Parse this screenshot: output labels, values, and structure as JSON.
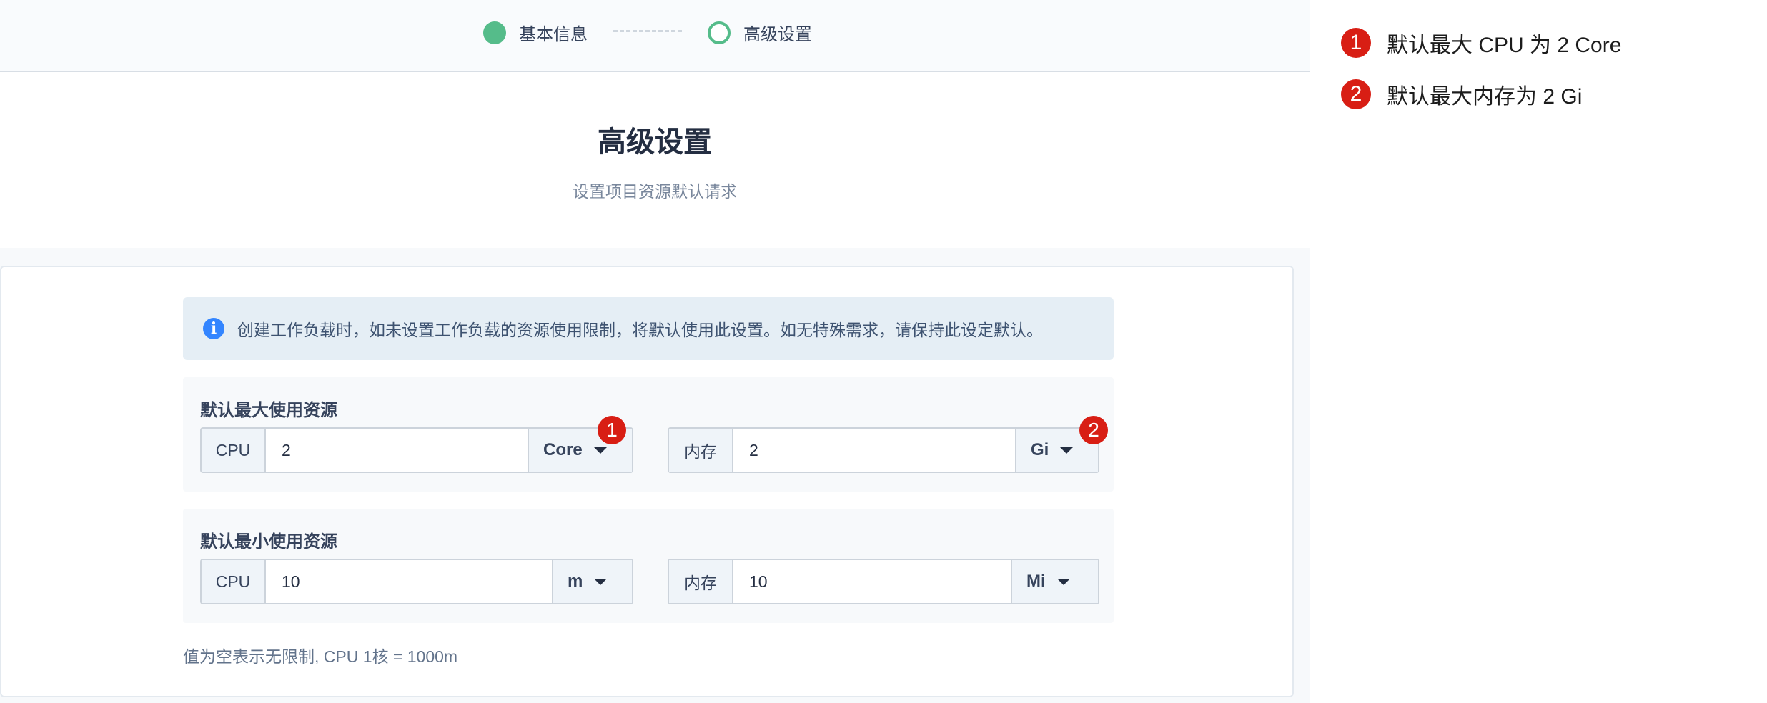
{
  "steps": [
    {
      "label": "基本信息",
      "state": "done"
    },
    {
      "label": "高级设置",
      "state": "active"
    }
  ],
  "header": {
    "title": "高级设置",
    "subtitle": "设置项目资源默认请求"
  },
  "alert": {
    "icon": "info-icon",
    "text": "创建工作负载时，如未设置工作负载的资源使用限制，将默认使用此设置。如无特殊需求，请保持此设定默认。"
  },
  "max_group": {
    "label": "默认最大使用资源",
    "cpu": {
      "addon": "CPU",
      "value": "2",
      "unit": "Core"
    },
    "memory": {
      "addon": "内存",
      "value": "2",
      "unit": "Gi"
    }
  },
  "min_group": {
    "label": "默认最小使用资源",
    "cpu": {
      "addon": "CPU",
      "value": "10",
      "unit": "m"
    },
    "memory": {
      "addon": "内存",
      "value": "10",
      "unit": "Mi"
    }
  },
  "note": "值为空表示无限制, CPU 1核 = 1000m",
  "annotations": [
    {
      "number": "1",
      "text": "默认最大 CPU 为 2 Core"
    },
    {
      "number": "2",
      "text": "默认最大内存为 2 Gi"
    }
  ],
  "colors": {
    "accent_green": "#55bc8a",
    "annotation_red": "#d81e14",
    "info_blue": "#3385ff"
  }
}
